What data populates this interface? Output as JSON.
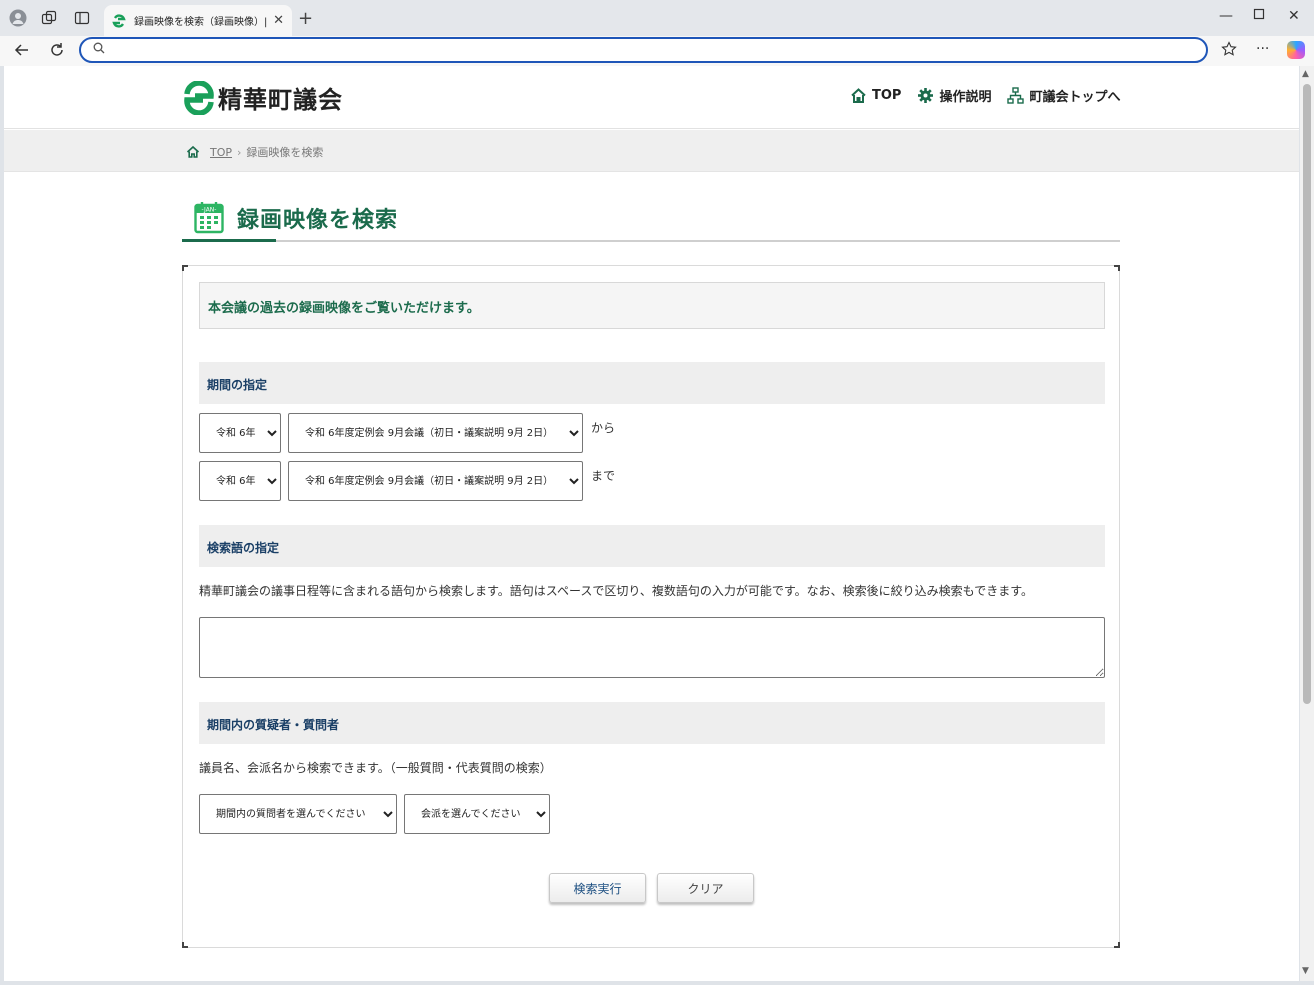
{
  "browser": {
    "tab_title": "録画映像を検索（録画映像）| 精華町議会",
    "address_value": ""
  },
  "site": {
    "name": "精華町議会",
    "nav": [
      {
        "label": "TOP",
        "icon": "home-icon"
      },
      {
        "label": "操作説明",
        "icon": "gear-icon"
      },
      {
        "label": "町議会トップへ",
        "icon": "sitemap-icon"
      }
    ]
  },
  "breadcrumb": {
    "top": "TOP",
    "separator": "›",
    "current": "録画映像を検索"
  },
  "page": {
    "title": "録画映像を検索",
    "calendar_icon_text": "-JAN-",
    "intro": "本会議の過去の録画映像をご覧いただけます。"
  },
  "period": {
    "heading": "期間の指定",
    "from": {
      "year": "令和 6年",
      "meeting": "令和 6年度定例会 9月会議（初日・議案説明 9月 2日）",
      "suffix": "から"
    },
    "to": {
      "year": "令和 6年",
      "meeting": "令和 6年度定例会 9月会議（初日・議案説明 9月 2日）",
      "suffix": "まで"
    }
  },
  "keyword": {
    "heading": "検索語の指定",
    "description": "精華町議会の議事日程等に含まれる語句から検索します。語句はスペースで区切り、複数語句の入力が可能です。なお、検索後に絞り込み検索もできます。",
    "value": ""
  },
  "questioner": {
    "heading": "期間内の質疑者・質問者",
    "description": "議員名、会派名から検索できます。（一般質問・代表質問の検索）",
    "member_select": "期間内の質問者を選んでください",
    "faction_select": "会派を選んでください"
  },
  "buttons": {
    "search": "検索実行",
    "clear": "クリア"
  },
  "colors": {
    "brand_green": "#1b6b4c",
    "heading_blue": "#1a3f66",
    "address_border": "#1f56b8"
  }
}
